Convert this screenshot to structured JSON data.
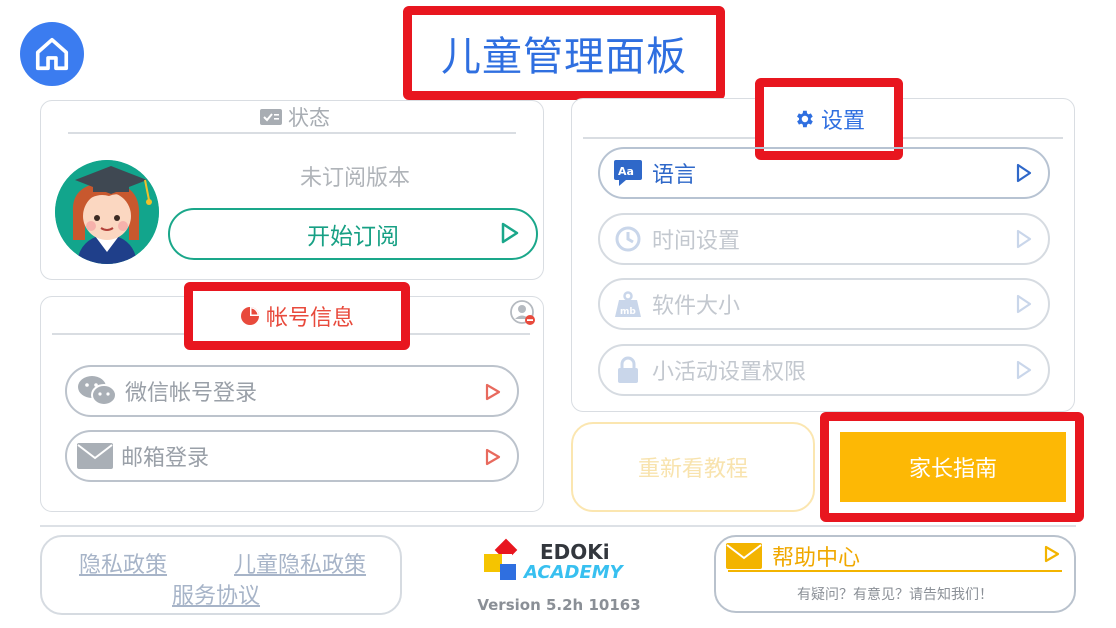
{
  "header": {
    "title": "儿童管理面板",
    "home_icon": "home-icon"
  },
  "status": {
    "heading": "状态",
    "version_text": "未订阅版本",
    "subscribe_label": "开始订阅"
  },
  "account": {
    "heading": "帐号信息",
    "items": [
      {
        "label": "微信帐号登录",
        "icon": "wechat-icon"
      },
      {
        "label": "邮箱登录",
        "icon": "mail-icon"
      }
    ]
  },
  "settings": {
    "heading": "设置",
    "items": [
      {
        "label": "语言",
        "icon": "language-icon",
        "active": true
      },
      {
        "label": "时间设置",
        "icon": "clock-icon",
        "active": false
      },
      {
        "label": "软件大小",
        "icon": "weight-icon",
        "active": false
      },
      {
        "label": "小活动设置权限",
        "icon": "lock-icon",
        "active": false
      }
    ]
  },
  "actions": {
    "tutorial_label": "重新看教程",
    "guide_label": "家长指南"
  },
  "footer": {
    "links": {
      "privacy": "隐私政策",
      "child_privacy": "儿童隐私政策",
      "terms": "服务协议"
    },
    "logo_line1": "EDOKi",
    "logo_line2": "ACADEMY",
    "version": "Version 5.2h 10163",
    "help_title": "帮助中心",
    "help_subtitle": "有疑问？有意见？请告知我们！"
  },
  "colors": {
    "accent_blue": "#2f6fe0",
    "teal": "#1aa78a",
    "highlight_red": "#e8161f",
    "guide_yellow": "#fdb805"
  }
}
